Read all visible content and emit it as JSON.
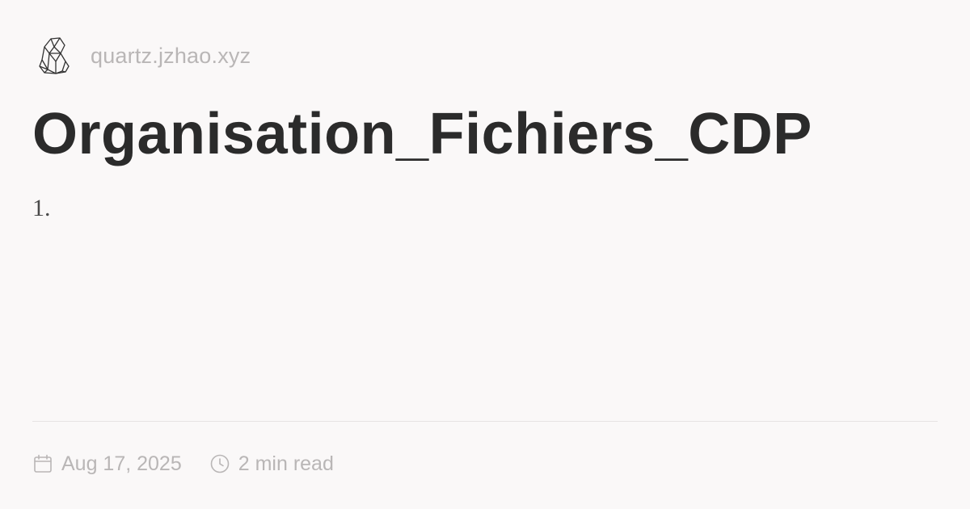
{
  "header": {
    "logo_icon": "crystal-icon",
    "site_name": "quartz.jzhao.xyz"
  },
  "page": {
    "title": "Organisation_Fichiers_CDP",
    "body_text": "1."
  },
  "meta": {
    "date_icon": "calendar-icon",
    "date": "Aug 17, 2025",
    "reading_time_icon": "clock-icon",
    "reading_time": "2 min read"
  },
  "colors": {
    "background": "#faf8f8",
    "title": "#2b2b2b",
    "muted": "#b9b6b6"
  }
}
